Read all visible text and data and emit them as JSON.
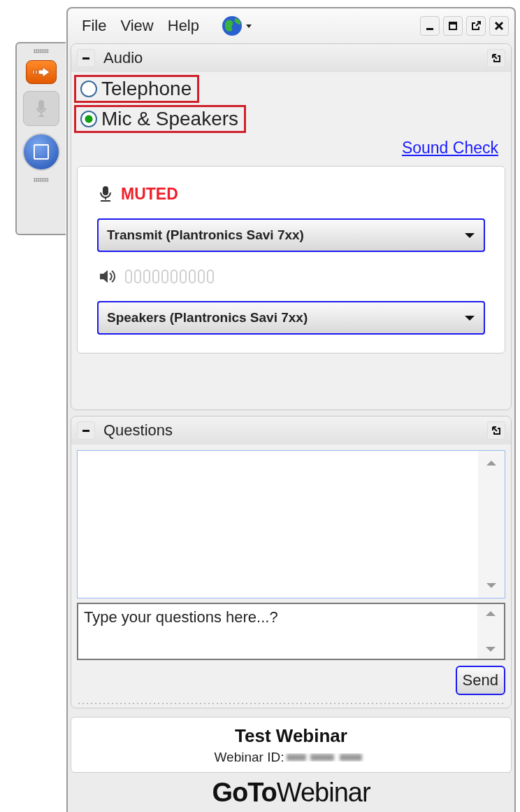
{
  "menu": [
    "File",
    "View",
    "Help"
  ],
  "audio": {
    "title": "Audio",
    "options": [
      {
        "label": "Telephone",
        "selected": false,
        "highlighted": true
      },
      {
        "label": "Mic & Speakers",
        "selected": true,
        "highlighted": true
      }
    ],
    "sound_check": "Sound Check",
    "mic_status": "MUTED",
    "microphone": "Transmit (Plantronics Savi 7xx)",
    "speakers": "Speakers (Plantronics Savi 7xx)"
  },
  "questions": {
    "title": "Questions",
    "placeholder": "Type your questions here...?",
    "send": "Send"
  },
  "webinar": {
    "title": "Test Webinar",
    "id_label": "Webinar ID:"
  },
  "logo": "**GoTo**Webinar"
}
